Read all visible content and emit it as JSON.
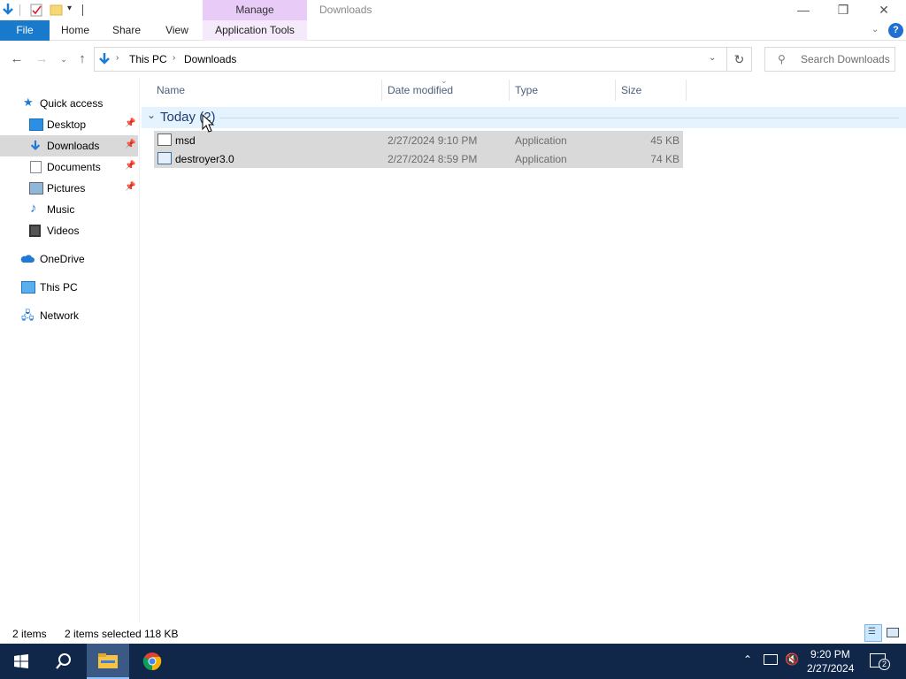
{
  "titlebar": {
    "manage_label": "Manage",
    "title": "Downloads",
    "minimize": "—",
    "restore": "❒",
    "close": "✕"
  },
  "ribbon": {
    "tabs": [
      "File",
      "Home",
      "Share",
      "View",
      "Application Tools"
    ]
  },
  "address": {
    "crumbs": [
      "This PC",
      "Downloads"
    ],
    "search_placeholder": "Search Downloads"
  },
  "navpane": {
    "items": [
      {
        "label": "Quick access"
      },
      {
        "label": "Desktop"
      },
      {
        "label": "Downloads"
      },
      {
        "label": "Documents"
      },
      {
        "label": "Pictures"
      },
      {
        "label": "Music"
      },
      {
        "label": "Videos"
      },
      {
        "label": "OneDrive"
      },
      {
        "label": "This PC"
      },
      {
        "label": "Network"
      }
    ]
  },
  "columns": {
    "name": "Name",
    "date": "Date modified",
    "type": "Type",
    "size": "Size"
  },
  "group": {
    "label": "Today (2)"
  },
  "files": [
    {
      "name": "msd",
      "date": "2/27/2024 9:10 PM",
      "type": "Application",
      "size": "45 KB"
    },
    {
      "name": "destroyer3.0",
      "date": "2/27/2024 8:59 PM",
      "type": "Application",
      "size": "74 KB"
    }
  ],
  "status": {
    "items": "2 items",
    "selected": "2 items selected",
    "size": "118 KB"
  },
  "taskbar": {
    "time": "9:20 PM",
    "date": "2/27/2024",
    "notifications": "2"
  },
  "colors": {
    "file_tab": "#1979ca",
    "manage_tab": "#e8ccf7",
    "selection": "#d9d9d9",
    "taskbar": "#10274a",
    "group_hdr": "#e5f3ff"
  }
}
